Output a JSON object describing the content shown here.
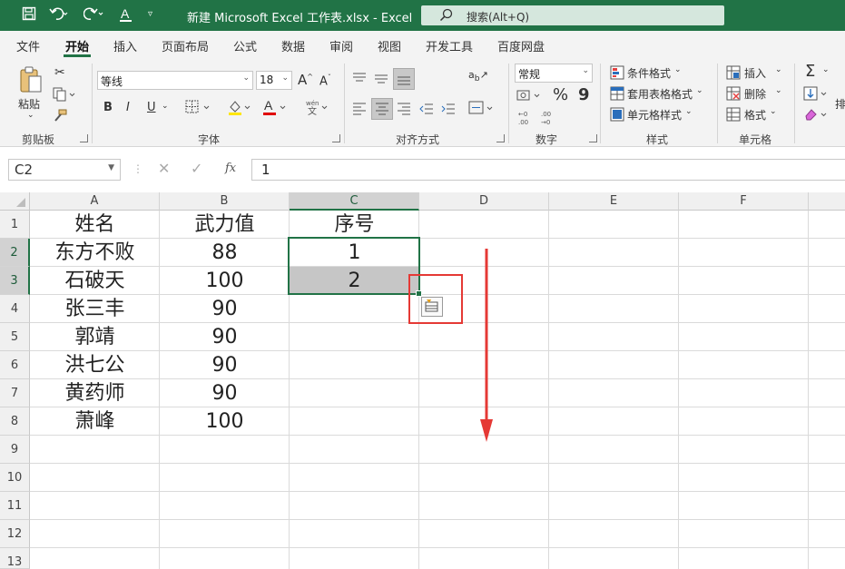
{
  "app": {
    "title": "新建 Microsoft Excel 工作表.xlsx  -  Excel",
    "search_placeholder": "搜索(Alt+Q)"
  },
  "ribbon_tabs": [
    "文件",
    "开始",
    "插入",
    "页面布局",
    "公式",
    "数据",
    "审阅",
    "视图",
    "开发工具",
    "百度网盘"
  ],
  "active_tab": "开始",
  "ribbon": {
    "clipboard": {
      "paste": "粘贴",
      "label": "剪贴板"
    },
    "font": {
      "name": "等线",
      "size": "18",
      "label": "字体",
      "bold": "B",
      "italic": "I",
      "underline": "U"
    },
    "alignment": {
      "label": "对齐方式"
    },
    "number": {
      "format": "常规",
      "label": "数字",
      "percent": "%",
      "comma": "9"
    },
    "styles": {
      "conditional": "条件格式",
      "table": "套用表格格式",
      "cell_styles": "单元格样式",
      "label": "样式"
    },
    "cells": {
      "insert": "插入",
      "delete": "删除",
      "format": "格式",
      "label": "单元格"
    },
    "editing": {
      "sum": "Σ"
    }
  },
  "formula_bar": {
    "name_box": "C2",
    "fx": "fx",
    "value": "1"
  },
  "sheet": {
    "columns": [
      "A",
      "B",
      "C",
      "D",
      "E",
      "F"
    ],
    "rows": [
      "1",
      "2",
      "3",
      "4",
      "5",
      "6",
      "7",
      "8",
      "9",
      "10",
      "11",
      "12",
      "13"
    ],
    "cells": [
      [
        "姓名",
        "武力值",
        "序号"
      ],
      [
        "东方不败",
        "88",
        "1"
      ],
      [
        "石破天",
        "100",
        "2"
      ],
      [
        "张三丰",
        "90",
        ""
      ],
      [
        "郭靖",
        "90",
        ""
      ],
      [
        "洪七公",
        "90",
        ""
      ],
      [
        "黄药师",
        "90",
        ""
      ],
      [
        "萧峰",
        "100",
        ""
      ]
    ],
    "selection": "C2:C3"
  },
  "colors": {
    "accent": "#217346",
    "highlight_box": "#e53935",
    "arrow": "#e53935"
  }
}
